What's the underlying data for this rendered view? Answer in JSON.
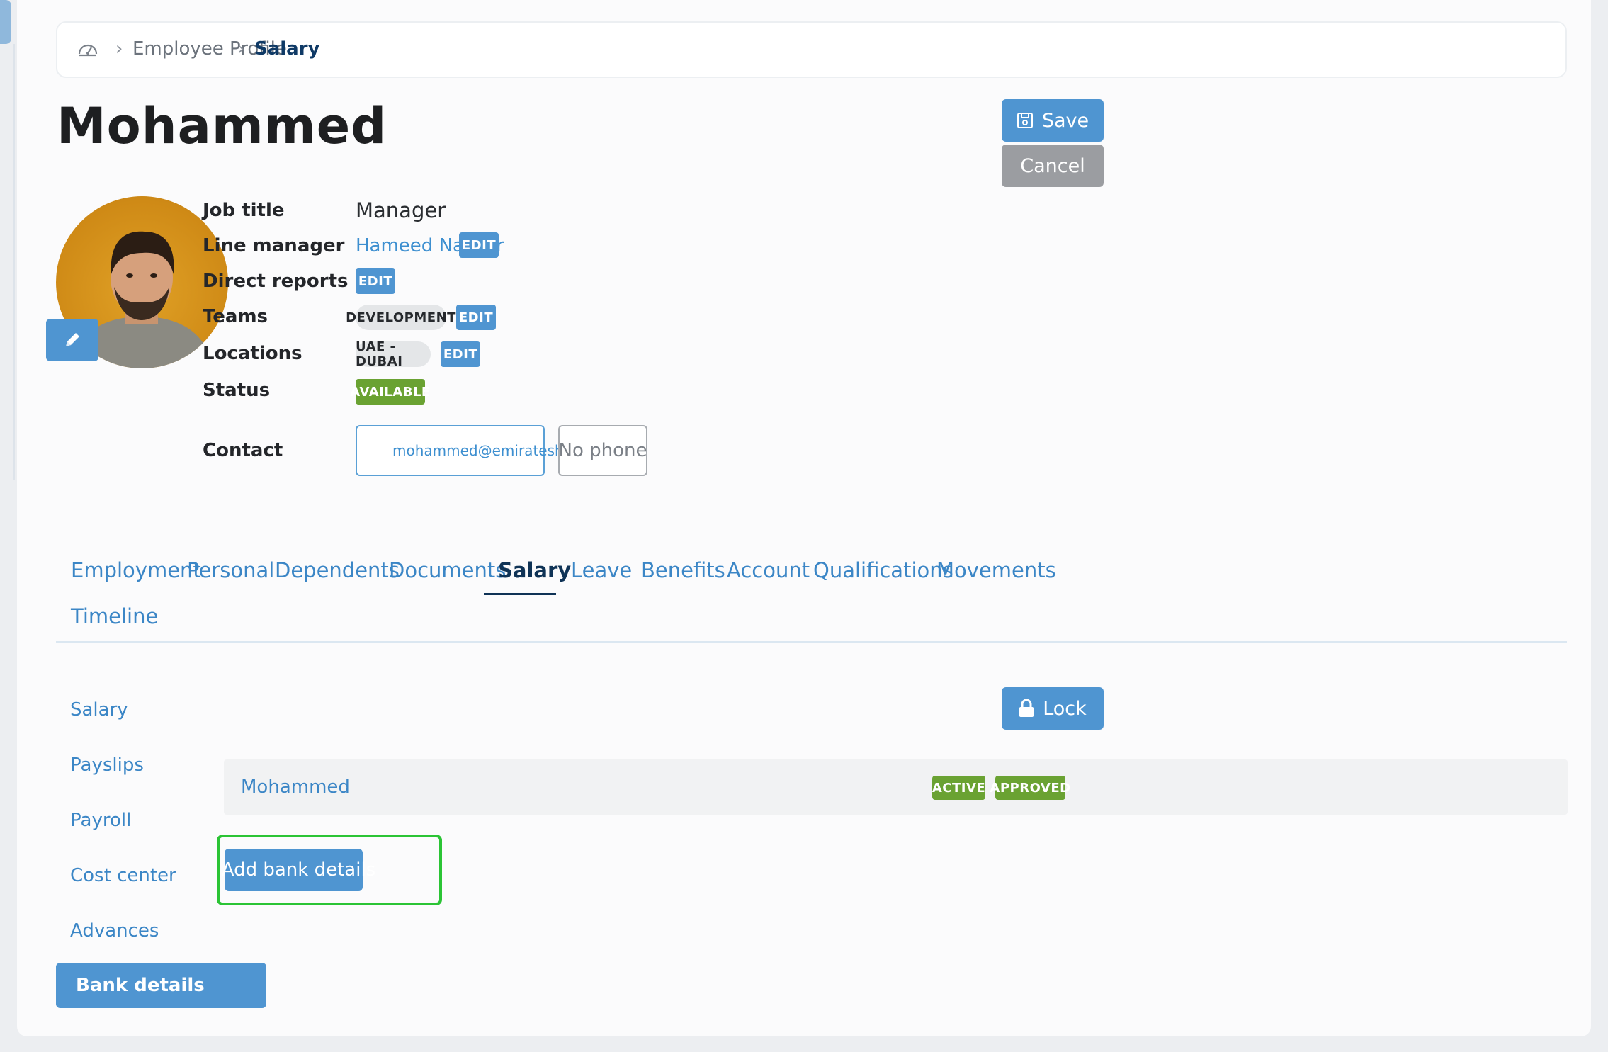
{
  "breadcrumb": {
    "items": [
      "Employee Profile",
      "Salary"
    ]
  },
  "employee": {
    "name": "Mohammed"
  },
  "header_actions": {
    "save_label": "Save",
    "cancel_label": "Cancel"
  },
  "profile": {
    "job_title_label": "Job title",
    "job_title_value": "Manager",
    "line_manager_label": "Line manager",
    "line_manager_value": "Hameed Naseer",
    "direct_reports_label": "Direct reports",
    "teams_label": "Teams",
    "teams_value": "DEVELOPMENT",
    "locations_label": "Locations",
    "locations_value": "UAE - DUBAI",
    "status_label": "Status",
    "status_value": "AVAILABLE",
    "contact_label": "Contact",
    "email": "mohammed@emirateshr.com",
    "phone": "No phone",
    "edit_label": "EDIT"
  },
  "tabs": [
    {
      "label": "Employment"
    },
    {
      "label": "Personal"
    },
    {
      "label": "Dependents"
    },
    {
      "label": "Documents"
    },
    {
      "label": "Salary",
      "active": true
    },
    {
      "label": "Leave"
    },
    {
      "label": "Benefits"
    },
    {
      "label": "Account"
    },
    {
      "label": "Qualifications"
    },
    {
      "label": "Movements"
    },
    {
      "label": "Timeline"
    }
  ],
  "salary_menu": [
    {
      "label": "Salary"
    },
    {
      "label": "Payslips"
    },
    {
      "label": "Payroll"
    },
    {
      "label": "Cost center"
    },
    {
      "label": "Advances"
    },
    {
      "label": "Bank details",
      "active": true
    }
  ],
  "section_actions": {
    "lock_label": "Lock"
  },
  "bank_record": {
    "name": "Mohammed",
    "badges": [
      "ACTIVE",
      "APPROVED"
    ]
  },
  "add_button": {
    "label": "Add bank details"
  },
  "colors": {
    "primary": "#4f95d1",
    "success": "#6aa232",
    "highlight": "#2bc435",
    "active_tab": "#0f3356"
  }
}
